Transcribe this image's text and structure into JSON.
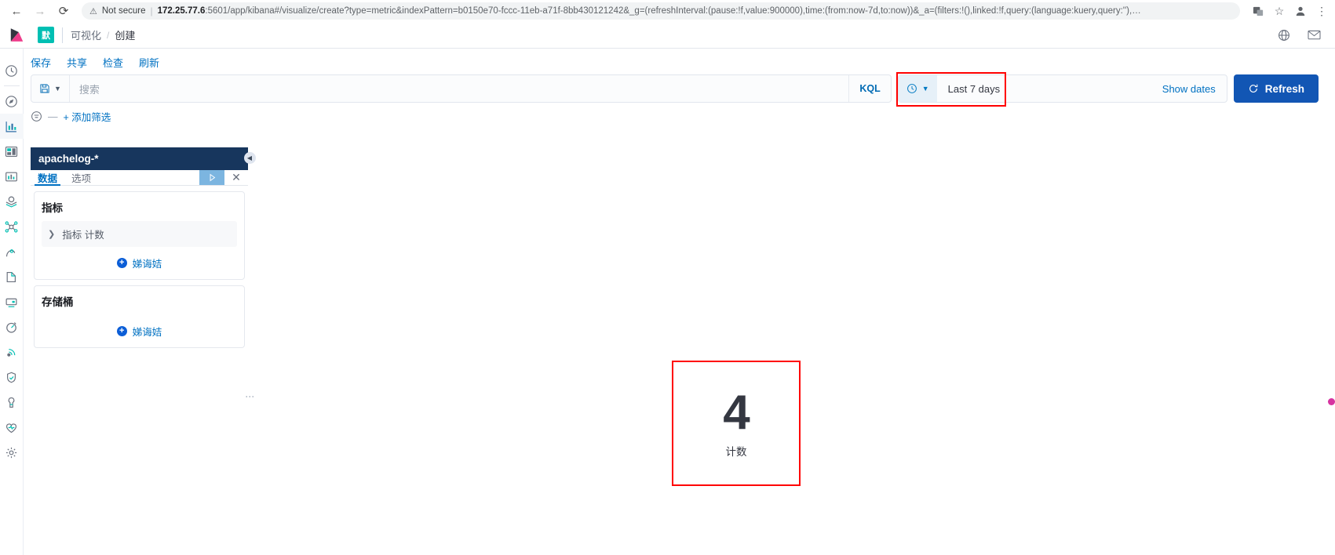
{
  "browser": {
    "back_label": "←",
    "forward_label": "→",
    "reload_label": "⟳",
    "security_label": "Not secure",
    "url_host": "172.25.77.6",
    "url_rest": ":5601/app/kibana#/visualize/create?type=metric&indexPattern=b0150e70-fccc-11eb-a71f-8bb430121242&_g=(refreshInterval:(pause:!f,value:900000),time:(from:now-7d,to:now))&_a=(filters:!(),linked:!f,query:(language:kuery,query:''),…"
  },
  "header": {
    "space_badge": "默",
    "breadcrumb": [
      {
        "label": "可视化"
      },
      {
        "label": "创建"
      }
    ]
  },
  "actions": [
    {
      "label": "保存"
    },
    {
      "label": "共享"
    },
    {
      "label": "检查"
    },
    {
      "label": "刷新"
    }
  ],
  "query_bar": {
    "search_placeholder": "搜索",
    "kql_label": "KQL",
    "date_value": "Last 7 days",
    "show_dates_label": "Show dates",
    "refresh_label": "Refresh",
    "highlight_color": "#ff0000"
  },
  "filter_bar": {
    "dash": "—",
    "add_filter_label": "+ 添加筛选"
  },
  "editor": {
    "index_pattern": "apachelog-*",
    "tabs": [
      {
        "label": "数据",
        "active": true
      },
      {
        "label": "选项",
        "active": false
      }
    ],
    "metrics_card": {
      "title": "指标",
      "row_label": "指标 计数",
      "add_label": "娣诲姞"
    },
    "buckets_card": {
      "title": "存储桶",
      "add_label": "娣诲姞"
    }
  },
  "visualization": {
    "value": "4",
    "label": "计数",
    "highlight_color": "#ff0000"
  },
  "sidebar": {
    "items": [
      {
        "name": "recently-viewed"
      },
      {
        "name": "discover"
      },
      {
        "name": "visualize"
      },
      {
        "name": "dashboard"
      },
      {
        "name": "canvas"
      },
      {
        "name": "maps"
      },
      {
        "name": "machine-learning"
      },
      {
        "name": "infrastructure"
      },
      {
        "name": "logs"
      },
      {
        "name": "apm"
      },
      {
        "name": "uptime"
      },
      {
        "name": "siem"
      },
      {
        "name": "dev-tools"
      },
      {
        "name": "monitoring"
      },
      {
        "name": "management"
      }
    ]
  }
}
